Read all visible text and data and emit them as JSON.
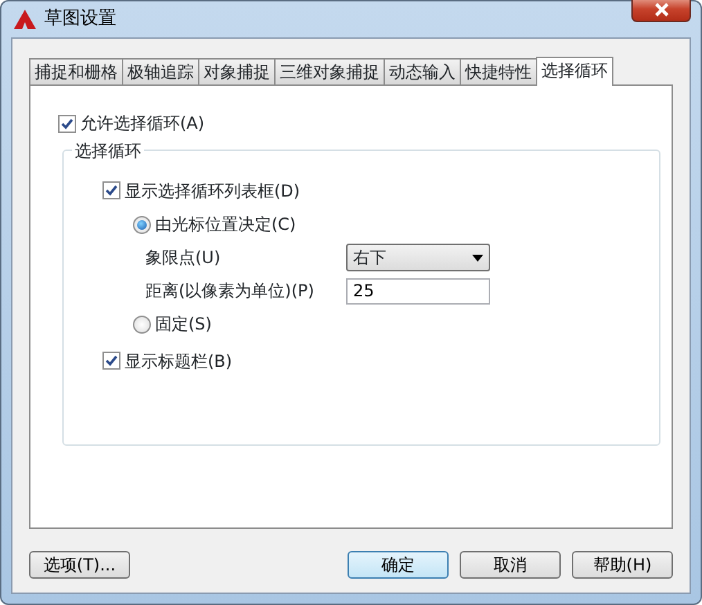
{
  "window": {
    "title": "草图设置"
  },
  "tabs": [
    {
      "label": "捕捉和栅格",
      "selected": false
    },
    {
      "label": "极轴追踪",
      "selected": false
    },
    {
      "label": "对象捕捉",
      "selected": false
    },
    {
      "label": "三维对象捕捉",
      "selected": false
    },
    {
      "label": "动态输入",
      "selected": false
    },
    {
      "label": "快捷特性",
      "selected": false
    },
    {
      "label": "选择循环",
      "selected": true
    }
  ],
  "allow_cycling": {
    "label": "允许选择循环(A)",
    "checked": true
  },
  "group": {
    "title": "选择循环",
    "show_list": {
      "label": "显示选择循环列表框(D)",
      "checked": true
    },
    "placement": [
      {
        "label": "由光标位置决定(C)",
        "selected": true,
        "settings": [
          {
            "kind": "dropdown",
            "label": "象限点(U)",
            "value": "右下"
          },
          {
            "kind": "field",
            "label": "距离(以像素为单位)(P)",
            "value": "25"
          }
        ]
      },
      {
        "label": "固定(S)",
        "selected": false
      }
    ],
    "show_titlebar": {
      "label": "显示标题栏(B)",
      "checked": true
    }
  },
  "buttons": [
    {
      "label": "选项(T)...",
      "default": false
    },
    {
      "label": "确定",
      "default": true
    },
    {
      "label": "取消",
      "default": false
    },
    {
      "label": "帮助(H)",
      "default": false
    }
  ]
}
